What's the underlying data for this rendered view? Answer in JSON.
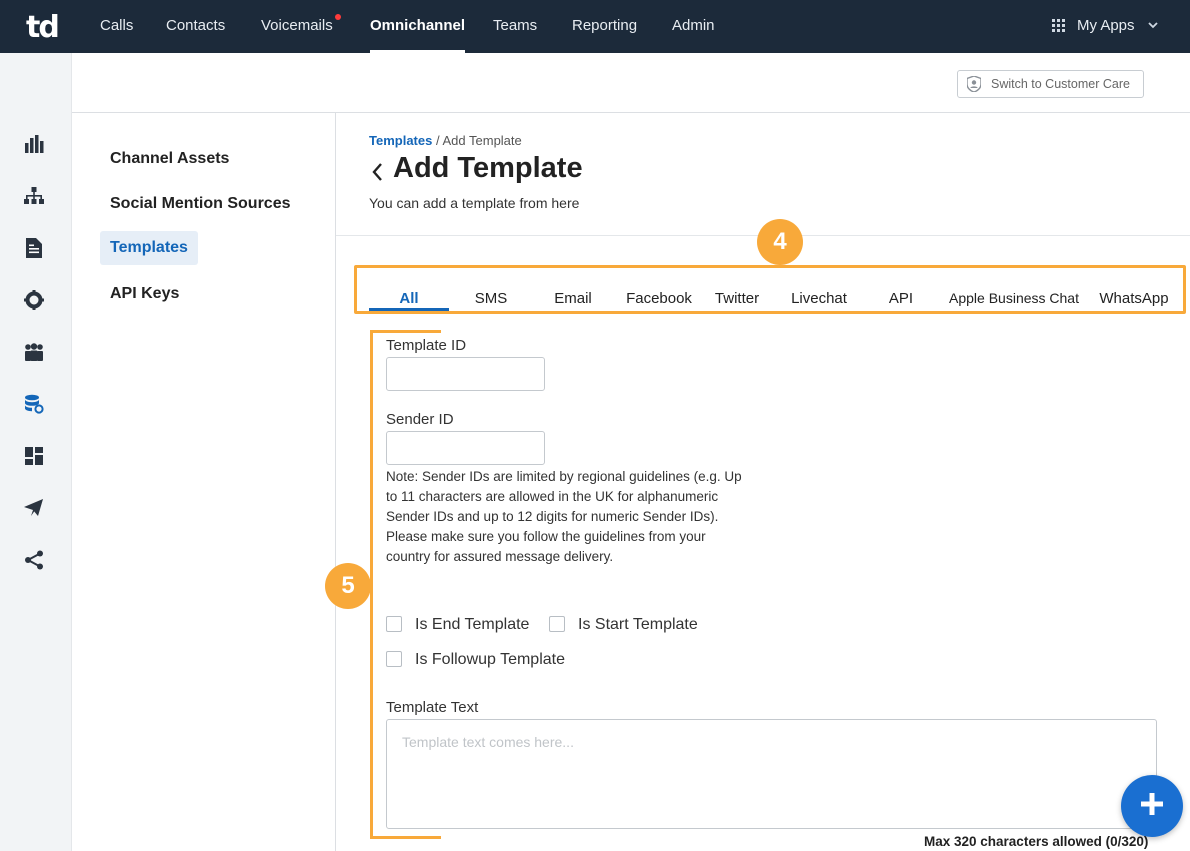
{
  "app": {
    "logo": "td",
    "nav": [
      {
        "label": "Calls"
      },
      {
        "label": "Contacts"
      },
      {
        "label": "Voicemails",
        "has_notification": true
      },
      {
        "label": "Omnichannel",
        "active": true
      },
      {
        "label": "Teams"
      },
      {
        "label": "Reporting"
      },
      {
        "label": "Admin"
      }
    ],
    "my_apps": "My Apps",
    "my_apps_icon": "grid-icon"
  },
  "rail": {
    "icons": [
      "bar-chart-icon",
      "org-chart-icon",
      "document-icon",
      "gear-icon",
      "people-icon",
      "database-settings-icon",
      "dashboard-icon",
      "send-icon",
      "share-icon"
    ],
    "active_index": 5
  },
  "header": {
    "switch_button": "Switch to Customer Care",
    "switch_icon": "shield-user-icon"
  },
  "sidebar": {
    "items": [
      {
        "label": "Channel Assets"
      },
      {
        "label": "Social Mention Sources"
      },
      {
        "label": "Templates",
        "active": true
      },
      {
        "label": "API Keys"
      }
    ]
  },
  "page": {
    "breadcrumb_link": "Templates",
    "breadcrumb_sep": "/",
    "breadcrumb_current": "Add Template",
    "title": "Add Template",
    "subtitle": "You can add a template from here"
  },
  "tabs": [
    {
      "label": "All",
      "active": true
    },
    {
      "label": "SMS"
    },
    {
      "label": "Email"
    },
    {
      "label": "Facebook"
    },
    {
      "label": "Twitter"
    },
    {
      "label": "Livechat"
    },
    {
      "label": "API"
    },
    {
      "label": "Apple Business Chat"
    },
    {
      "label": "WhatsApp"
    }
  ],
  "annotations": {
    "badge_tabs": "4",
    "badge_form": "5",
    "color": "#f8a93a"
  },
  "form": {
    "template_id_label": "Template ID",
    "template_id_value": "",
    "sender_id_label": "Sender ID",
    "sender_id_value": "",
    "note": "Note: Sender IDs are limited by regional guidelines (e.g. Up to 11 characters are allowed in the UK for alphanumeric Sender IDs and up to 12 digits for numeric Sender IDs). Please make sure you follow the guidelines from your country for assured message delivery.",
    "checkboxes": [
      {
        "label": "Is End Template",
        "checked": false
      },
      {
        "label": "Is Start Template",
        "checked": false
      },
      {
        "label": "Is Followup Template",
        "checked": false
      }
    ],
    "template_text_label": "Template Text",
    "template_text_placeholder": "Template text comes here...",
    "max_chars": "Max 320 characters allowed (0/320)"
  },
  "fab_icon": "plus-icon",
  "colors": {
    "nav_bg": "#1c2a3a",
    "accent": "#1466b8",
    "fab": "#1a6fd1"
  }
}
